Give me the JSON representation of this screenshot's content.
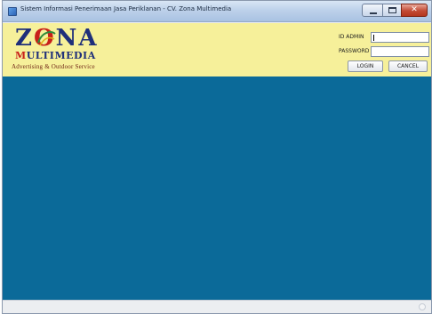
{
  "window": {
    "title": "Sistem Informasi Penerimaan Jasa Periklanan - CV. Zona Multimedia",
    "controls": {
      "minimize": "minimize-icon",
      "maximize": "maximize-icon",
      "close": "close-icon"
    }
  },
  "logo": {
    "brand_prefix": "Z",
    "brand_o": "O",
    "brand_suffix": "NA",
    "sub_m": "M",
    "sub_rest": "ULTIMEDIA",
    "tagline": "Advertising & Outdoor Service"
  },
  "login": {
    "id_label": "ID ADMIN",
    "id_value": "",
    "password_label": "PASSWORD",
    "password_value": "",
    "login_button": "LOGIN",
    "cancel_button": "CANCEL"
  },
  "colors": {
    "header_bg": "#f6f09a",
    "main_bg": "#0b6a99",
    "brand_blue": "#1f2f7a",
    "brand_red": "#c8201a"
  }
}
